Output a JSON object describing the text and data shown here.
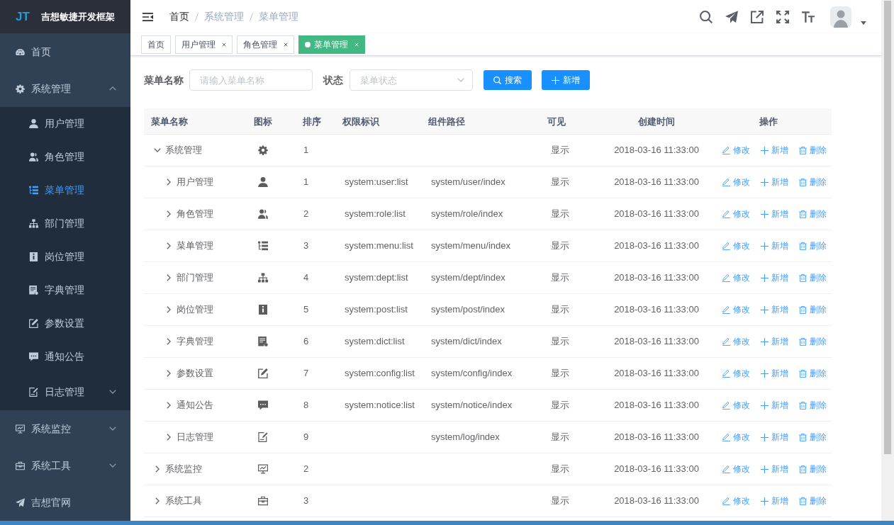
{
  "sidebar": {
    "logo": "JT",
    "title": "吉想敏捷开发框架",
    "items": [
      {
        "label": "首页",
        "selected": false
      },
      {
        "label": "系统管理",
        "selected": false,
        "expanded": true,
        "children": [
          {
            "label": "用户管理",
            "selected": false
          },
          {
            "label": "角色管理",
            "selected": false
          },
          {
            "label": "菜单管理",
            "selected": true
          },
          {
            "label": "部门管理",
            "selected": false
          },
          {
            "label": "岗位管理",
            "selected": false
          },
          {
            "label": "字典管理",
            "selected": false
          },
          {
            "label": "参数设置",
            "selected": false
          },
          {
            "label": "通知公告",
            "selected": false
          },
          {
            "label": "日志管理",
            "selected": false,
            "expanded": false
          }
        ]
      },
      {
        "label": "系统监控",
        "selected": false,
        "expanded": false
      },
      {
        "label": "系统工具",
        "selected": false,
        "expanded": false
      },
      {
        "label": "吉想官网",
        "selected": false
      }
    ]
  },
  "navbar": {
    "breadcrumb": [
      {
        "label": "首页",
        "link": true
      },
      {
        "label": "系统管理",
        "link": false
      },
      {
        "label": "菜单管理",
        "link": false
      }
    ]
  },
  "tags": [
    {
      "label": "首页",
      "selected": false,
      "closable": false
    },
    {
      "label": "用户管理",
      "selected": false,
      "closable": true
    },
    {
      "label": "角色管理",
      "selected": false,
      "closable": true
    },
    {
      "label": "菜单管理",
      "selected": true,
      "closable": true
    }
  ],
  "search_form": {
    "fields": [
      {
        "kind": "input",
        "label": "菜单名称",
        "placeholder": "请输入菜单名称"
      },
      {
        "kind": "select",
        "label": "状态",
        "placeholder": "菜单状态"
      }
    ],
    "buttons": [
      {
        "kind": "search",
        "label": "搜索"
      },
      {
        "kind": "add",
        "label": "新增"
      }
    ]
  },
  "table": {
    "columns": [
      "菜单名称",
      "图标",
      "排序",
      "权限标识",
      "组件路径",
      "可见",
      "创建时间",
      "操作"
    ],
    "rows": [
      {
        "menu_name": "系统管理",
        "order": "1",
        "visible": "显示",
        "created_time": "2018-03-16 11:33:00",
        "actions": [
          "修改",
          "新增",
          "删除"
        ],
        "expanded": true,
        "children": [
          {
            "menu_name": "用户管理",
            "order": "1",
            "permission": "system:user:list",
            "component_path": "system/user/index",
            "visible": "显示",
            "created_time": "2018-03-16 11:33:00",
            "actions": [
              "修改",
              "新增",
              "删除"
            ],
            "expanded": false
          },
          {
            "menu_name": "角色管理",
            "order": "2",
            "permission": "system:role:list",
            "component_path": "system/role/index",
            "visible": "显示",
            "created_time": "2018-03-16 11:33:00",
            "actions": [
              "修改",
              "新增",
              "删除"
            ],
            "expanded": false
          },
          {
            "menu_name": "菜单管理",
            "order": "3",
            "permission": "system:menu:list",
            "component_path": "system/menu/index",
            "visible": "显示",
            "created_time": "2018-03-16 11:33:00",
            "actions": [
              "修改",
              "新增",
              "删除"
            ],
            "expanded": false
          },
          {
            "menu_name": "部门管理",
            "order": "4",
            "permission": "system:dept:list",
            "component_path": "system/dept/index",
            "visible": "显示",
            "created_time": "2018-03-16 11:33:00",
            "actions": [
              "修改",
              "新增",
              "删除"
            ],
            "expanded": false
          },
          {
            "menu_name": "岗位管理",
            "order": "5",
            "permission": "system:post:list",
            "component_path": "system/post/index",
            "visible": "显示",
            "created_time": "2018-03-16 11:33:00",
            "actions": [
              "修改",
              "新增",
              "删除"
            ],
            "expanded": false
          },
          {
            "menu_name": "字典管理",
            "order": "6",
            "permission": "system:dict:list",
            "component_path": "system/dict/index",
            "visible": "显示",
            "created_time": "2018-03-16 11:33:00",
            "actions": [
              "修改",
              "新增",
              "删除"
            ],
            "expanded": false
          },
          {
            "menu_name": "参数设置",
            "order": "7",
            "permission": "system:config:list",
            "component_path": "system/config/index",
            "visible": "显示",
            "created_time": "2018-03-16 11:33:00",
            "actions": [
              "修改",
              "新增",
              "删除"
            ],
            "expanded": false
          },
          {
            "menu_name": "通知公告",
            "order": "8",
            "permission": "system:notice:list",
            "component_path": "system/notice/index",
            "visible": "显示",
            "created_time": "2018-03-16 11:33:00",
            "actions": [
              "修改",
              "新增",
              "删除"
            ],
            "expanded": false
          },
          {
            "menu_name": "日志管理",
            "order": "9",
            "component_path": "system/log/index",
            "visible": "显示",
            "created_time": "2018-03-16 11:33:00",
            "actions": [
              "修改",
              "新增",
              "删除"
            ],
            "expanded": false
          }
        ]
      },
      {
        "menu_name": "系统监控",
        "order": "2",
        "visible": "显示",
        "created_time": "2018-03-16 11:33:00",
        "actions": [
          "修改",
          "新增",
          "删除"
        ],
        "expanded": false
      },
      {
        "menu_name": "系统工具",
        "order": "3",
        "visible": "显示",
        "created_time": "2018-03-16 11:33:00",
        "actions": [
          "修改",
          "新增",
          "删除"
        ],
        "expanded": false
      }
    ]
  }
}
